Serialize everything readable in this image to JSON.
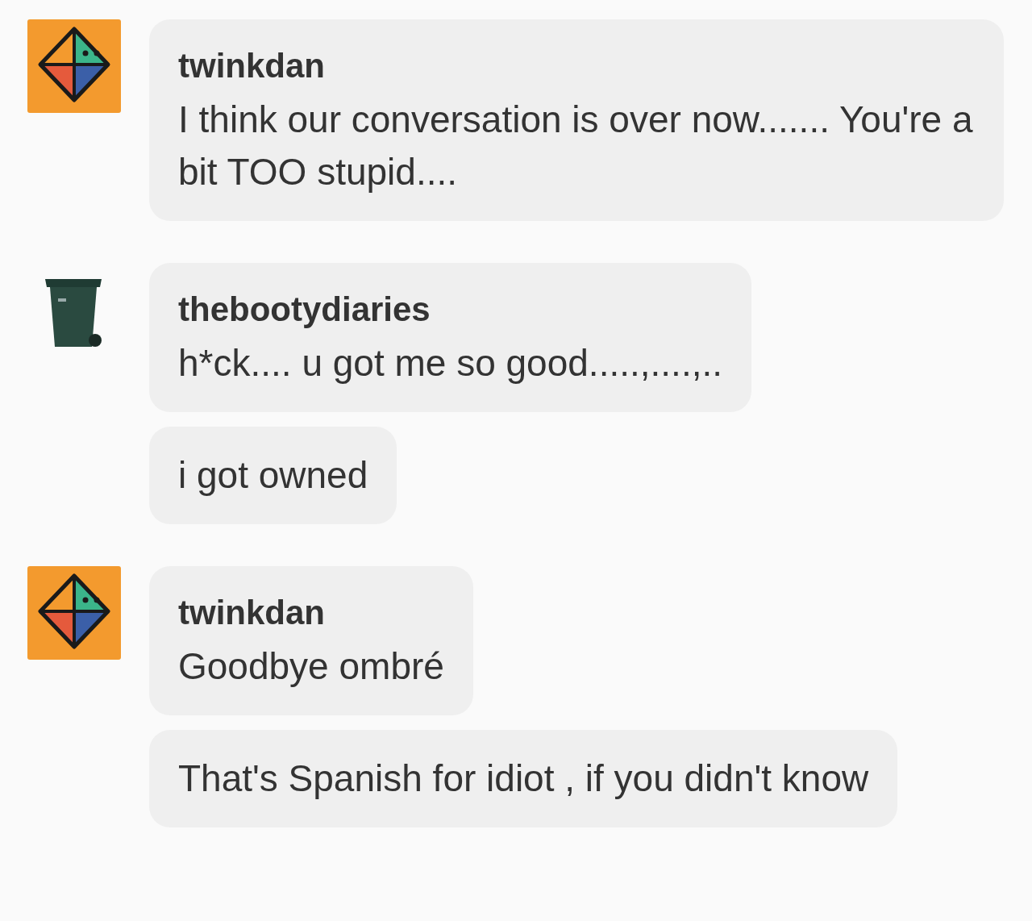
{
  "groups": [
    {
      "author": "twinkdan",
      "avatar": {
        "kind": "diamond"
      },
      "messages": [
        "I think our conversation is over now....... You're a bit TOO stupid...."
      ]
    },
    {
      "author": "thebootydiaries",
      "avatar": {
        "kind": "trashcan"
      },
      "messages": [
        "h*ck.... u got me so good.....,....,..",
        "i got owned"
      ]
    },
    {
      "author": "twinkdan",
      "avatar": {
        "kind": "diamond"
      },
      "messages": [
        "Goodbye ombré",
        "That's Spanish for idiot , if you didn't know"
      ]
    }
  ]
}
